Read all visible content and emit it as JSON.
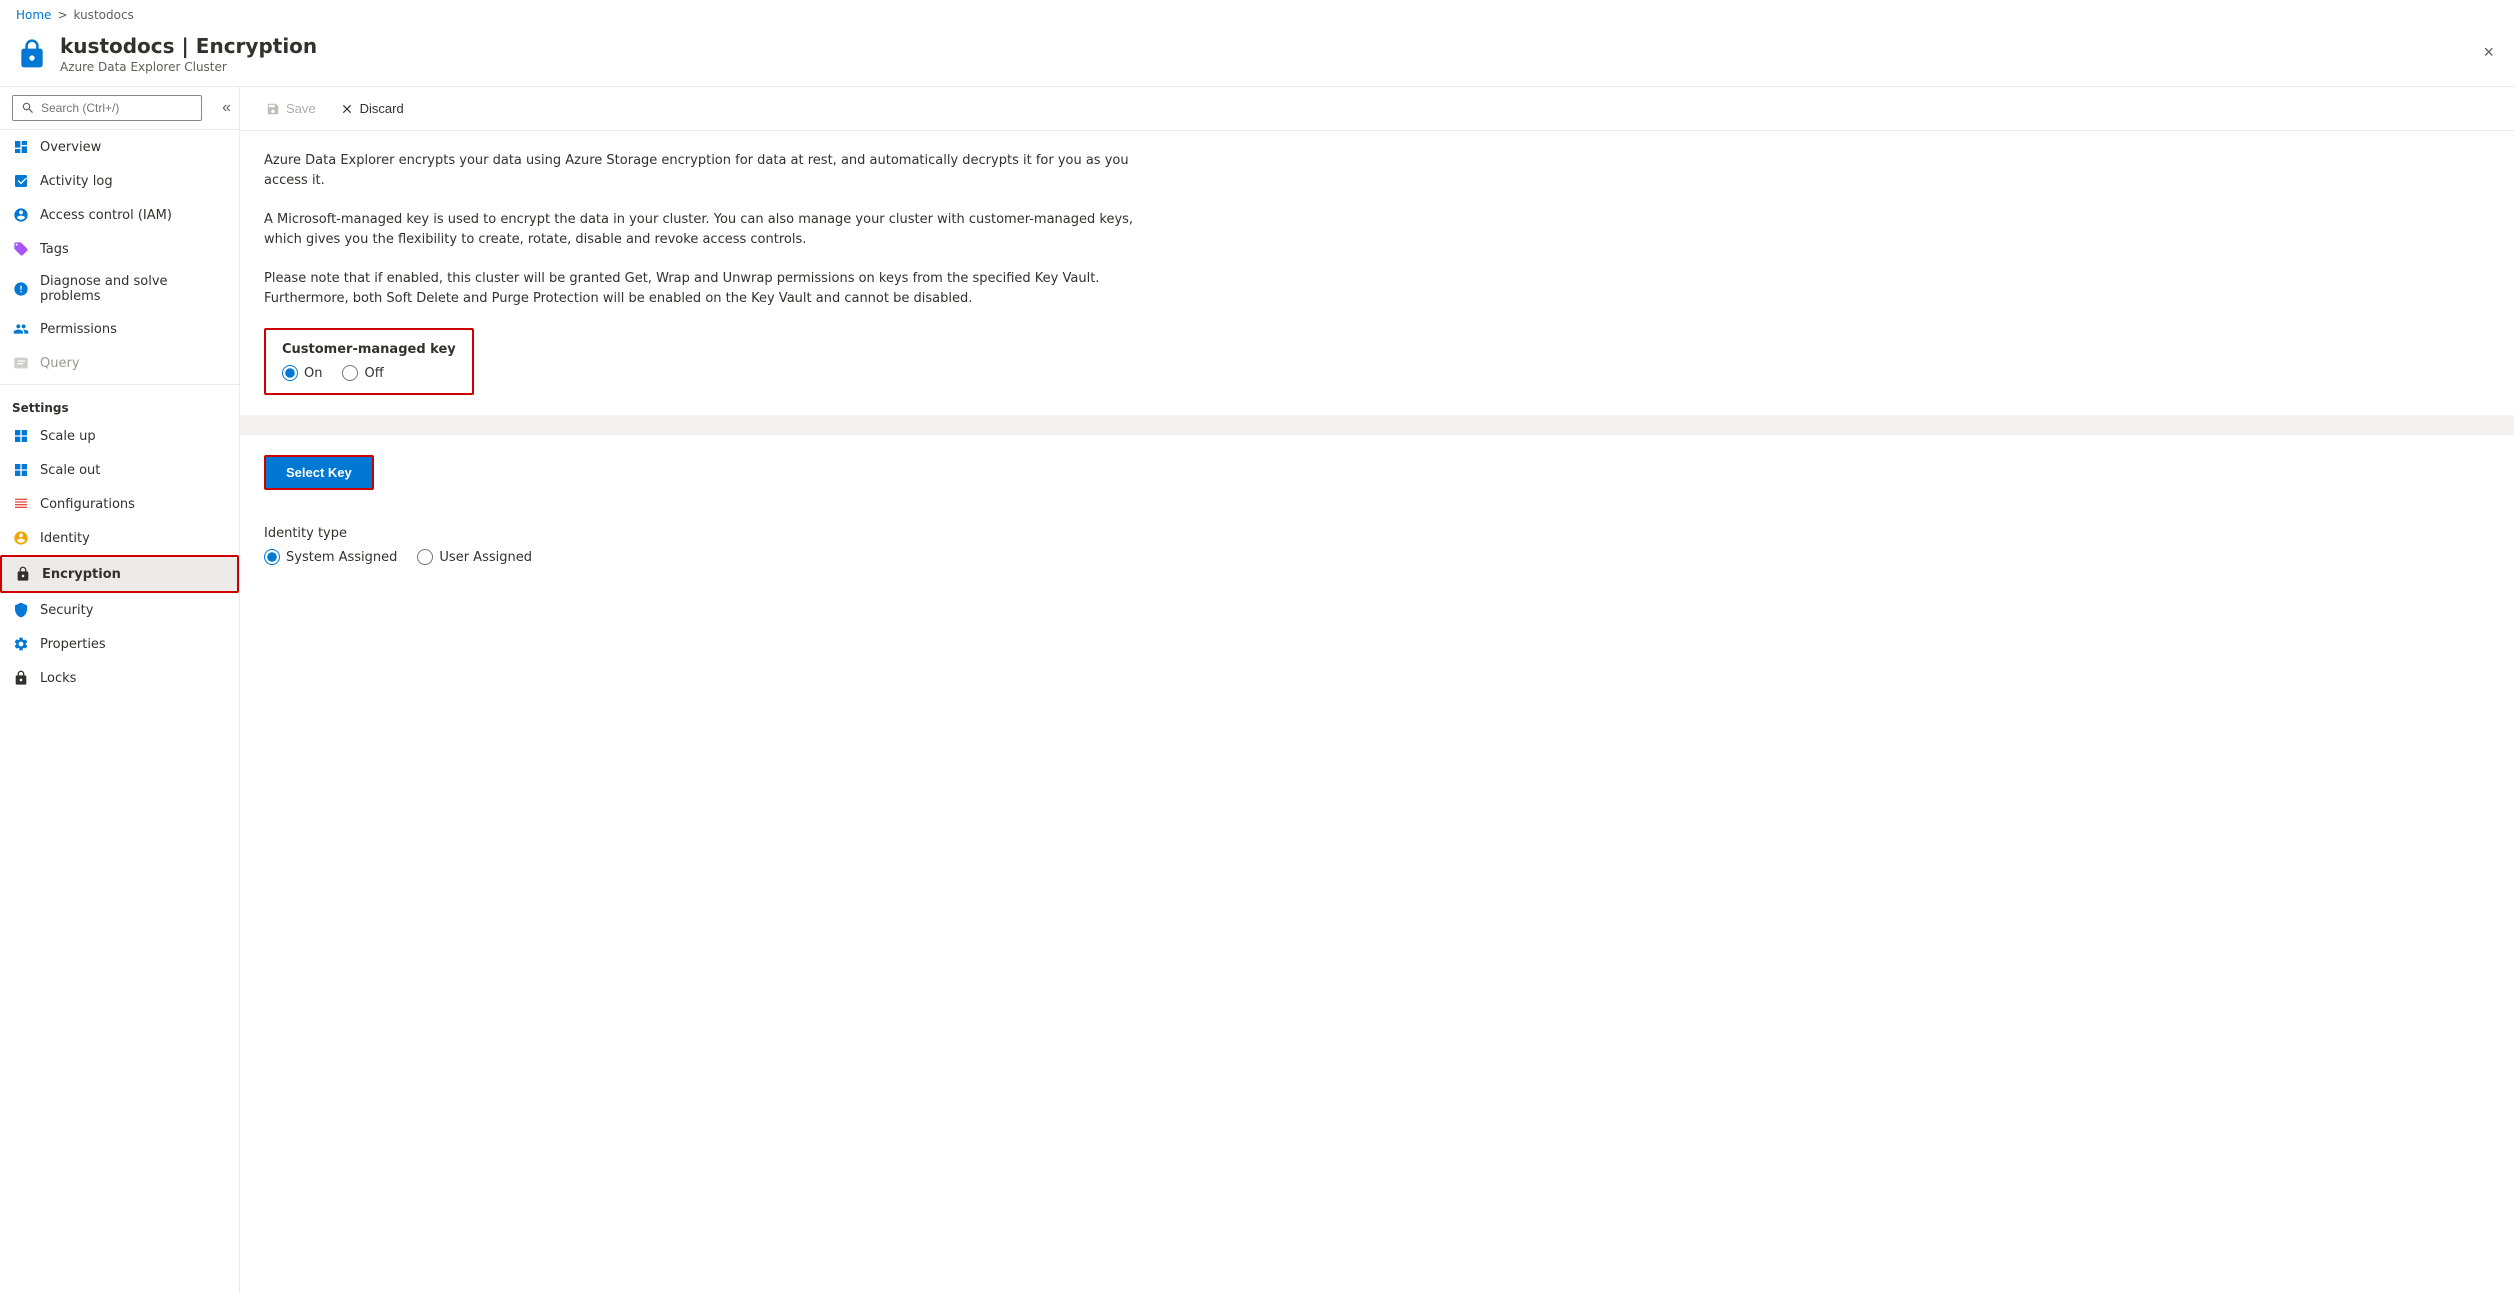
{
  "breadcrumb": {
    "home": "Home",
    "separator": ">",
    "current": "kustodocs"
  },
  "header": {
    "title": "kustodocs | Encryption",
    "subtitle": "Azure Data Explorer Cluster",
    "close_label": "×"
  },
  "sidebar": {
    "search_placeholder": "Search (Ctrl+/)",
    "collapse_icon": "«",
    "nav_items": [
      {
        "id": "overview",
        "label": "Overview",
        "icon": "overview"
      },
      {
        "id": "activity-log",
        "label": "Activity log",
        "icon": "activity"
      },
      {
        "id": "access-control",
        "label": "Access control (IAM)",
        "icon": "access"
      },
      {
        "id": "tags",
        "label": "Tags",
        "icon": "tags"
      },
      {
        "id": "diagnose",
        "label": "Diagnose and solve problems",
        "icon": "diagnose"
      },
      {
        "id": "permissions",
        "label": "Permissions",
        "icon": "permissions"
      },
      {
        "id": "query",
        "label": "Query",
        "icon": "query",
        "disabled": true
      }
    ],
    "settings_header": "Settings",
    "settings_items": [
      {
        "id": "scale-up",
        "label": "Scale up",
        "icon": "scale-up"
      },
      {
        "id": "scale-out",
        "label": "Scale out",
        "icon": "scale-out"
      },
      {
        "id": "configurations",
        "label": "Configurations",
        "icon": "configurations"
      },
      {
        "id": "identity",
        "label": "Identity",
        "icon": "identity"
      },
      {
        "id": "encryption",
        "label": "Encryption",
        "icon": "encryption",
        "active": true
      },
      {
        "id": "security",
        "label": "Security",
        "icon": "security"
      },
      {
        "id": "properties",
        "label": "Properties",
        "icon": "properties"
      },
      {
        "id": "locks",
        "label": "Locks",
        "icon": "locks"
      }
    ]
  },
  "toolbar": {
    "save_label": "Save",
    "discard_label": "Discard"
  },
  "content": {
    "info_text_1": "Azure Data Explorer encrypts your data using Azure Storage encryption for data at rest, and automatically decrypts it for you as you access it.",
    "info_text_2": "A Microsoft-managed key is used to encrypt the data in your cluster. You can also manage your cluster with customer-managed keys, which gives you the flexibility to create, rotate, disable and revoke access controls.",
    "info_text_3": "Please note that if enabled, this cluster will be granted Get, Wrap and Unwrap permissions on keys from the specified Key Vault. Furthermore, both Soft Delete and Purge Protection will be enabled on the Key Vault and cannot be disabled.",
    "cmk_section": {
      "label": "Customer-managed key",
      "on_label": "On",
      "off_label": "Off",
      "selected": "on"
    },
    "select_key_label": "Select Key",
    "identity_type": {
      "label": "Identity type",
      "system_assigned_label": "System Assigned",
      "user_assigned_label": "User Assigned",
      "selected": "system"
    }
  }
}
